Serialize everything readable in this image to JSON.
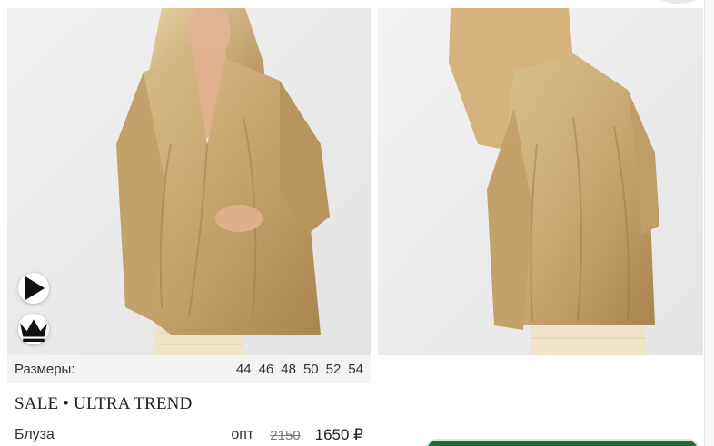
{
  "product": {
    "sizes_label": "Размеры:",
    "sizes": [
      "44",
      "46",
      "48",
      "50",
      "52",
      "54"
    ],
    "brand": "SALE • ULTRA TREND",
    "name": "Блуза",
    "opt_label": "опт",
    "old_price": "2150",
    "new_price": "1650 ₽"
  },
  "icons": {
    "video": "play-icon",
    "premium": "crown-icon"
  },
  "colors": {
    "blouse": "#c9a874",
    "accent_green": "#1f6b3a"
  }
}
